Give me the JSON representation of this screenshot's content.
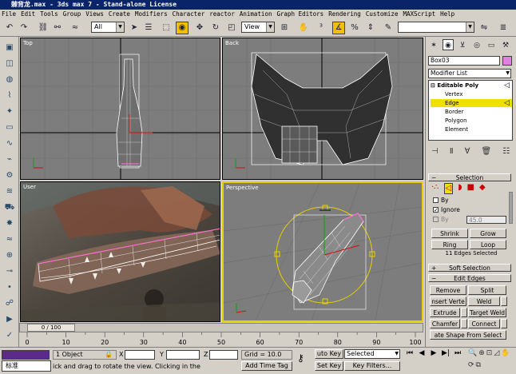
{
  "window": {
    "title": "棘背龙.max - 3ds max 7 - Stand-alone License"
  },
  "menu": [
    "File",
    "Edit",
    "Tools",
    "Group",
    "Views",
    "Create",
    "Modifiers",
    "Character",
    "reactor",
    "Animation",
    "Graph Editors",
    "Rendering",
    "Customize",
    "MAXScript",
    "Help"
  ],
  "toolbar": {
    "selection_filter": "All",
    "coord_system": "View"
  },
  "viewports": {
    "top": "Top",
    "back": "Back",
    "user": "User",
    "perspective": "Perspective"
  },
  "command_panel": {
    "object_name": "Box03",
    "modifier_list": "Modifier List",
    "stack": {
      "root": "Editable Poly",
      "subobjects": [
        "Vertex",
        "Edge",
        "Border",
        "Polygon",
        "Element"
      ],
      "selected_index": 1
    },
    "selection": {
      "title": "Selection",
      "by_label": "By",
      "ignore_label": "Ignore",
      "by_angle_label": "By",
      "angle_value": "45.0",
      "shrink": "Shrink",
      "grow": "Grow",
      "ring": "Ring",
      "loop": "Loop",
      "status": "11 Edges Selected"
    },
    "soft_selection": "Soft Selection",
    "edit_edges": {
      "title": "Edit Edges",
      "remove": "Remove",
      "split": "Split",
      "insert_vertex": "nsert Verte",
      "weld": "Weld",
      "extrude": "Extrude",
      "target_weld": "Target Weld",
      "chamfer": "Chamfer",
      "connect": "Connect",
      "create_shape": "ate Shape From Select"
    }
  },
  "timeline": {
    "slider": "0 / 100",
    "ticks": [
      "0",
      "10",
      "20",
      "30",
      "40",
      "50",
      "60",
      "70",
      "80",
      "90",
      "100"
    ]
  },
  "status": {
    "objects": "1 Object",
    "x_label": "X",
    "y_label": "Y",
    "z_label": "Z",
    "grid": "Grid = 10.0",
    "prompt": "ick and drag to rotate the view.  Clicking in the",
    "add_time_tag": "Add Time Tag",
    "auto_key": "uto Key",
    "set_key": "Set Key",
    "key_mode": "Selected",
    "key_filters": "Key Filters...",
    "ime": "标准"
  },
  "colors": {
    "title_bar": "#0a246a",
    "active_viewport": "#e8d000",
    "selection_highlight": "#f0e000"
  }
}
